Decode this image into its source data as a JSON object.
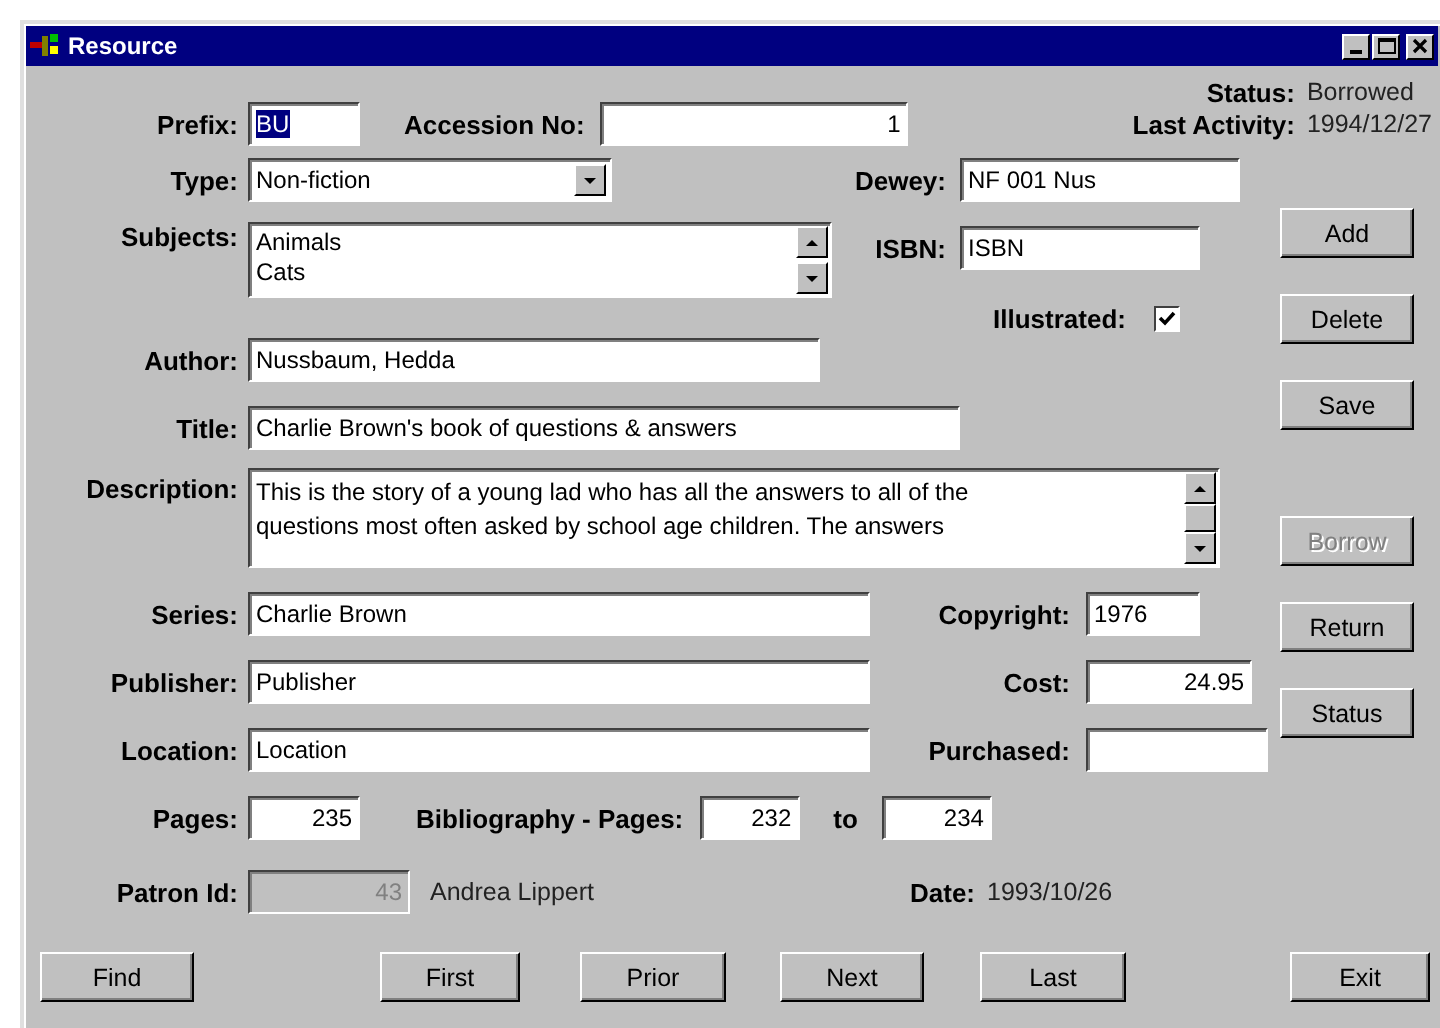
{
  "window": {
    "title": "Resource"
  },
  "status": [
    {
      "label": "Status:",
      "value": "Borrowed"
    },
    {
      "label": "Last Activity:",
      "value": "1994/12/27"
    }
  ],
  "prefix": {
    "label": "Prefix:",
    "value": "BU",
    "highlighted": true
  },
  "accession": {
    "label": "Accession No:",
    "value": "1"
  },
  "type": {
    "label": "Type:",
    "value": "Non-fiction"
  },
  "dewey": {
    "label": "Dewey:",
    "value": "NF 001 Nus"
  },
  "subjects": {
    "label": "Subjects:",
    "items": [
      "Animals",
      "Cats"
    ]
  },
  "isbn": {
    "label": "ISBN:",
    "value": "ISBN"
  },
  "illustrated": {
    "label": "Illustrated:",
    "checked": true
  },
  "author": {
    "label": "Author:",
    "value": "Nussbaum, Hedda"
  },
  "title": {
    "label": "Title:",
    "value": "Charlie Brown's book of questions & answers"
  },
  "description": {
    "label": "Description:",
    "lines": [
      "This is the story of a young lad who has all the answers to all of the",
      "questions most often asked by school age children. The answers"
    ]
  },
  "series": {
    "label": "Series:",
    "value": "Charlie Brown"
  },
  "copyright": {
    "label": "Copyright:",
    "value": "1976"
  },
  "publisher": {
    "label": "Publisher:",
    "value": "Publisher"
  },
  "cost": {
    "label": "Cost:",
    "value": "24.95"
  },
  "location": {
    "label": "Location:",
    "value": "Location"
  },
  "purchased": {
    "label": "Purchased:"
  },
  "pages": {
    "label": "Pages:",
    "value": "235"
  },
  "bibliography": {
    "label": "Bibliography - Pages:",
    "from": "232",
    "to_label": "to",
    "to": "234"
  },
  "patron": {
    "label": "Patron Id:",
    "value": "43",
    "name": "Andrea Lippert",
    "disabled": true
  },
  "date": {
    "label": "Date:",
    "value": "1993/10/26"
  },
  "side_buttons": [
    {
      "label": "Add",
      "disabled": false
    },
    {
      "label": "Delete",
      "disabled": false
    },
    {
      "label": "Save",
      "disabled": false
    },
    {
      "label": "Borrow",
      "disabled": true
    },
    {
      "label": "Return",
      "disabled": false
    },
    {
      "label": "Status",
      "disabled": false
    }
  ],
  "nav_buttons": [
    {
      "label": "Find",
      "disabled": false
    },
    {
      "label": "First",
      "disabled": false
    },
    {
      "label": "Prior",
      "disabled": false
    },
    {
      "label": "Next",
      "disabled": false
    },
    {
      "label": "Last",
      "disabled": false
    },
    {
      "label": "Exit",
      "disabled": false
    }
  ]
}
